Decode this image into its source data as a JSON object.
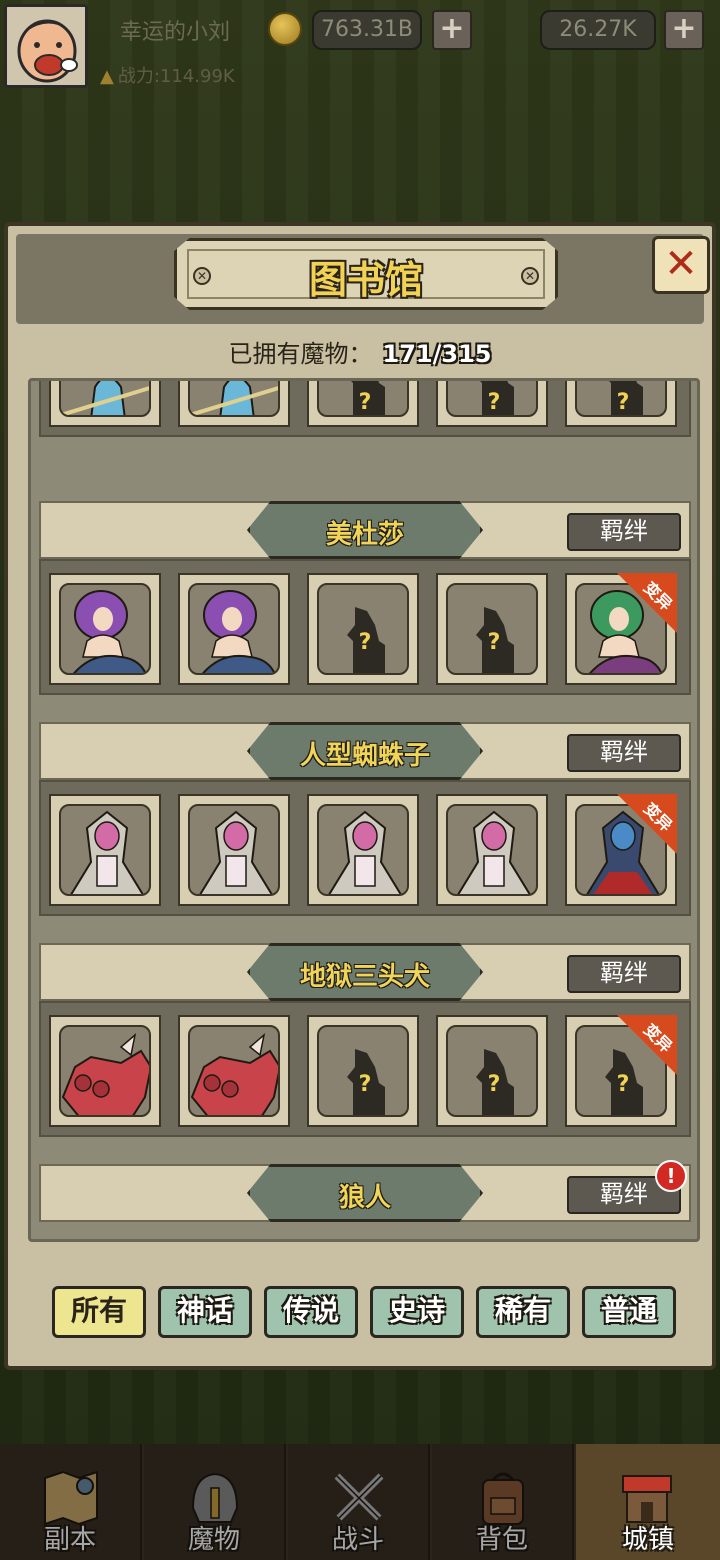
{
  "player": {
    "name": "幸运的小刘",
    "power_label": "战力:114.99K"
  },
  "resources": {
    "gold": "763.31B",
    "gems": "26.27K",
    "plus": "+"
  },
  "library": {
    "title": "图书馆",
    "close_label": "✕",
    "owned_label": "已拥有魔物：",
    "owned_count": "171/315",
    "bond_label": "羁绊",
    "mutant_label": "变异",
    "unknown_mark": "?",
    "alert_mark": "!",
    "groups": [
      {
        "name": "美杜莎",
        "cards": [
          "medusa",
          "medusa",
          "unknown",
          "unknown",
          "medusa-mutant"
        ]
      },
      {
        "name": "人型蜘蛛子",
        "cards": [
          "spider",
          "spider",
          "spider",
          "spider",
          "spider-mutant"
        ]
      },
      {
        "name": "地狱三头犬",
        "cards": [
          "cerberus",
          "cerberus",
          "unknown",
          "unknown",
          "unknown-mutant"
        ]
      },
      {
        "name": "狼人",
        "cards": []
      }
    ]
  },
  "filters": [
    "所有",
    "神话",
    "传说",
    "史诗",
    "稀有",
    "普通"
  ],
  "active_filter": "所有",
  "nav": [
    {
      "label": "副本",
      "icon": "map-icon"
    },
    {
      "label": "魔物",
      "icon": "helmet-icon"
    },
    {
      "label": "战斗",
      "icon": "crossed-swords-icon"
    },
    {
      "label": "背包",
      "icon": "backpack-icon"
    },
    {
      "label": "城镇",
      "icon": "town-icon"
    }
  ],
  "colors": {
    "title_gold": "#f2d255",
    "tab_active": "#ede590",
    "tab_inactive": "#9fc3ad",
    "mutant_ribbon": "#d64a1e",
    "close_x": "#b02a1a"
  }
}
